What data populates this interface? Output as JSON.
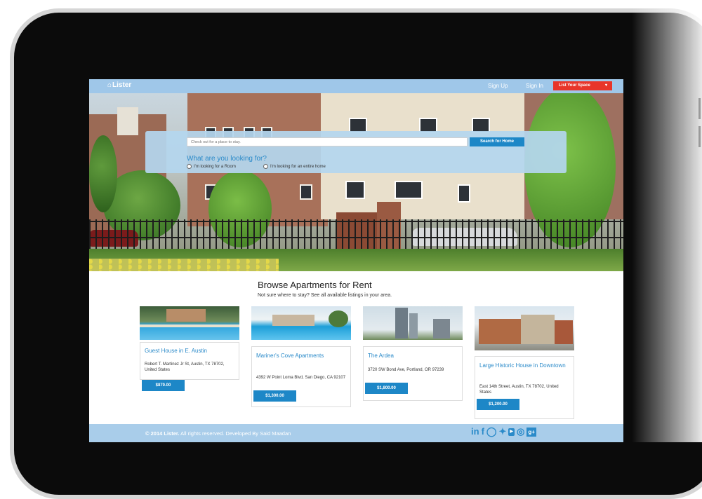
{
  "navbar": {
    "brand": "Lister",
    "sign_up": "Sign Up",
    "sign_in": "Sign In",
    "list_space": "List Your Space"
  },
  "search": {
    "placeholder": "Check out for a place to stay.",
    "button": "Search for Home",
    "question": "What are you looking for?",
    "options": [
      "I'm looking for a Room",
      "I'm looking for an entire home"
    ]
  },
  "browse": {
    "title": "Browse Apartments for Rent",
    "subtitle": "Not sure where to stay? See all available listings in your area."
  },
  "listings": [
    {
      "title": "Guest House in E. Austin",
      "address": "Robert T. Martinez Jr St, Austin, TX 78702, United States",
      "price": "$870.00"
    },
    {
      "title": "Mariner's Cove Apartments",
      "address": "4392 W Point Loma Blvd, San Diego, CA 92107",
      "price": "$1,300.00"
    },
    {
      "title": "The Ardea",
      "address": "3720 SW Bond Ave, Portland, OR 97239",
      "price": "$1,800.00"
    },
    {
      "title": "Large Historic House in Downtown",
      "address": "East 14th Street, Austin, TX 78702, United States",
      "price": "$1,200.00"
    }
  ],
  "footer": {
    "brand": "© 2014 Lister.",
    "text": " All rights reserved. Developed By Said Maadan",
    "social_icons": [
      "linkedin-icon",
      "facebook-icon",
      "github-icon",
      "twitter-icon",
      "youtube-icon",
      "dribbble-icon",
      "google-plus-icon"
    ]
  },
  "colors": {
    "navbar": "#9fc7e9",
    "accent": "#1d87c7",
    "list_space": "#e8352a",
    "footer": "#a9cdea"
  }
}
